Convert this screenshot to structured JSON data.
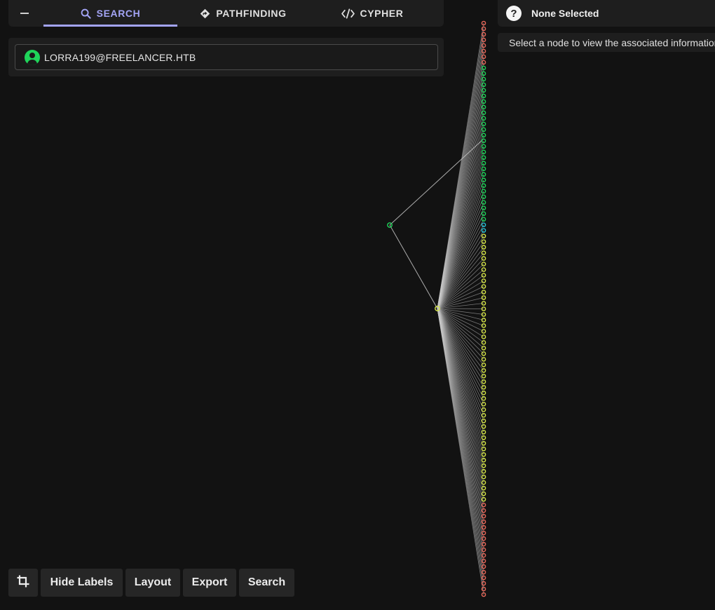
{
  "tabs": {
    "search_label": "SEARCH",
    "pathfinding_label": "PATHFINDING",
    "cypher_label": "CYPHER",
    "active": "search"
  },
  "search": {
    "value": "LORRA199@FREELANCER.HTB"
  },
  "info_panel": {
    "title": "None Selected",
    "message": "Select a node to view the associated information"
  },
  "toolbar": {
    "hide_labels": "Hide Labels",
    "layout": "Layout",
    "export": "Export",
    "search": "Search"
  },
  "colors": {
    "accent": "#a3a4f5",
    "user_node": "#1fd45a",
    "group_node": "#d8e84a",
    "computer_node": "#e8685a",
    "other_node": "#27c3d8",
    "edge": "#c8c8c8"
  },
  "graph": {
    "source_node_type": "user",
    "hub_node_type": "group",
    "column_node_types": [
      "computer",
      "computer",
      "computer",
      "computer",
      "computer",
      "computer",
      "computer",
      "computer",
      "user",
      "user",
      "user",
      "user",
      "user",
      "user",
      "user",
      "user",
      "user",
      "user",
      "user",
      "user",
      "user",
      "user",
      "user",
      "user",
      "user",
      "user",
      "user",
      "user",
      "user",
      "user",
      "user",
      "user",
      "user",
      "user",
      "user",
      "user",
      "other",
      "other",
      "group",
      "group",
      "group",
      "group",
      "group",
      "group",
      "group",
      "group",
      "group",
      "group",
      "group",
      "group",
      "group",
      "group",
      "group",
      "group",
      "group",
      "group",
      "group",
      "group",
      "group",
      "group",
      "group",
      "group",
      "group",
      "group",
      "group",
      "group",
      "group",
      "group",
      "group",
      "group",
      "group",
      "group",
      "group",
      "group",
      "group",
      "group",
      "group",
      "group",
      "group",
      "group",
      "group",
      "group",
      "group",
      "group",
      "group",
      "group",
      "computer",
      "computer",
      "computer",
      "computer",
      "computer",
      "computer",
      "computer",
      "computer",
      "computer",
      "computer",
      "computer",
      "computer",
      "computer",
      "computer",
      "computer",
      "computer",
      "computer"
    ]
  }
}
